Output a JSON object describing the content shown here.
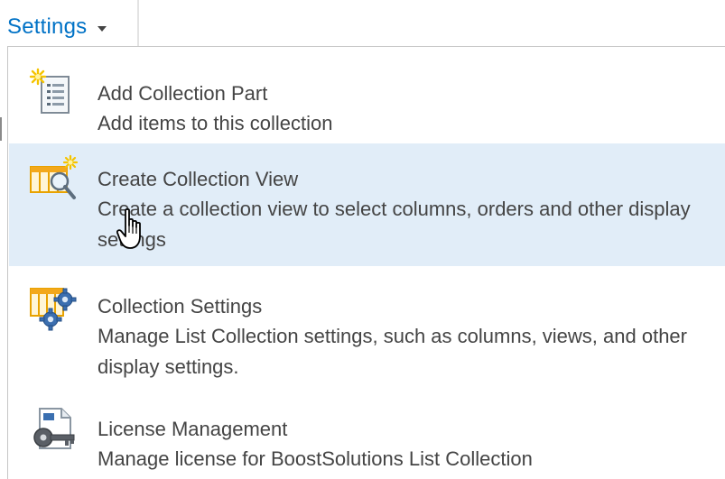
{
  "settings_menu": {
    "trigger_label": "Settings",
    "trigger_icon": "chevron-down-icon",
    "items": [
      {
        "title": "Add Collection Part",
        "description": "Add items to this collection",
        "icon": "add-part-document-icon"
      },
      {
        "title": "Create Collection View",
        "description": "Create a collection view to select columns, orders and other display settings",
        "icon": "create-view-magnifier-icon"
      },
      {
        "title": "Collection Settings",
        "description": "Manage List Collection settings, such as columns, views, and other display settings.",
        "icon": "settings-gears-icon"
      },
      {
        "title": "License Management",
        "description": "Manage license for BoostSolutions List Collection",
        "icon": "license-key-icon"
      }
    ],
    "hovered_item_index": 1
  },
  "colors": {
    "accent": "#0072c6",
    "hover_background": "#e1edf8",
    "text": "#444444",
    "border": "#c6c6c6"
  }
}
